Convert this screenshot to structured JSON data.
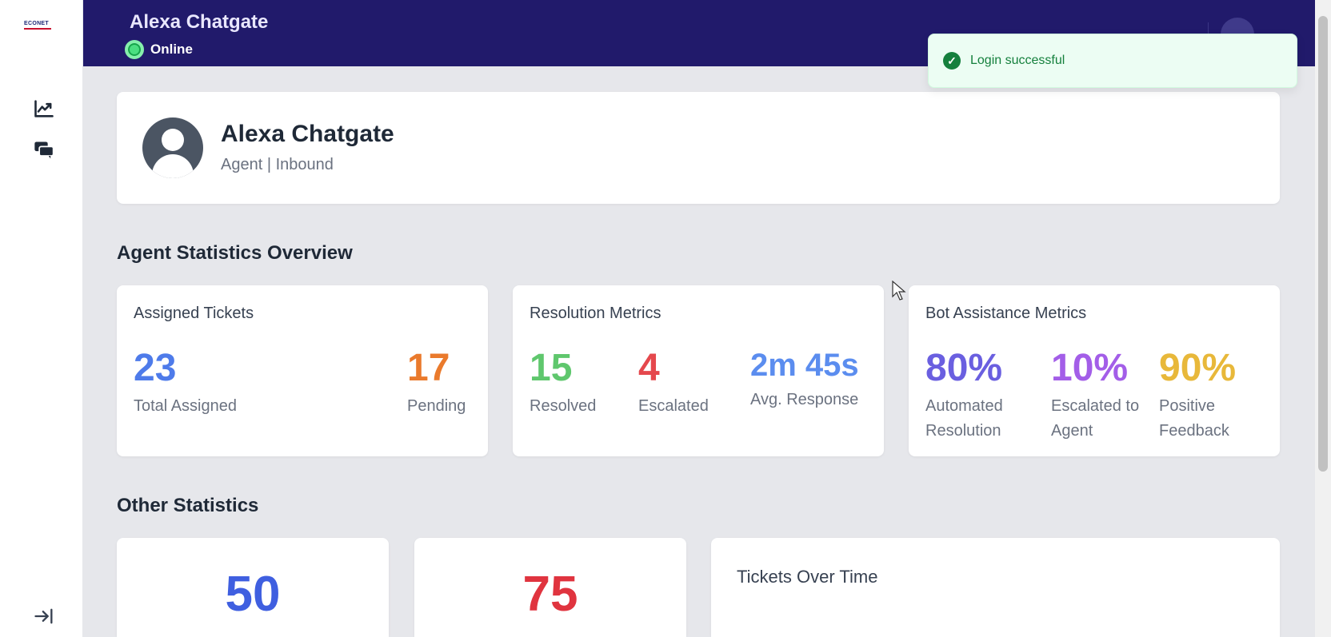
{
  "sidebar": {
    "logo_text": "ECONET",
    "items": [
      {
        "icon": "chart-line-icon"
      },
      {
        "icon": "chat-bubbles-icon"
      }
    ],
    "collapse_icon": "collapse-arrow-icon"
  },
  "header": {
    "title": "Alexa Chatgate",
    "status": "Online",
    "status_color": "#4ade80",
    "background": "#211a6b"
  },
  "toast": {
    "message": "Login successful",
    "icon": "check-circle-icon",
    "color": "#15803d"
  },
  "profile": {
    "name": "Alexa Chatgate",
    "role": "Agent | Inbound",
    "avatar_icon": "user-avatar-icon"
  },
  "overview": {
    "title": "Agent Statistics Overview",
    "cards": [
      {
        "title": "Assigned Tickets",
        "metrics": [
          {
            "value": "23",
            "label": "Total Assigned",
            "color": "#4e7bea"
          },
          {
            "value": "17",
            "label": "Pending",
            "color": "#ea7a2c"
          }
        ]
      },
      {
        "title": "Resolution Metrics",
        "metrics": [
          {
            "value": "15",
            "label": "Resolved",
            "color": "#5fc76d"
          },
          {
            "value": "4",
            "label": "Escalated",
            "color": "#e5484d"
          },
          {
            "value": "2m 45s",
            "label": "Avg. Response",
            "color": "#5b8def"
          }
        ]
      },
      {
        "title": "Bot Assistance Metrics",
        "metrics": [
          {
            "value": "80%",
            "label_line1": "Automated",
            "label_line2": "Resolution",
            "color": "#6a5fe0"
          },
          {
            "value": "10%",
            "label_line1": "Escalated to",
            "label_line2": "Agent",
            "color": "#a35ee8"
          },
          {
            "value": "90%",
            "label_line1": "Positive",
            "label_line2": "Feedback",
            "color": "#e8b83a"
          }
        ]
      }
    ]
  },
  "other": {
    "title": "Other Statistics",
    "stats": [
      {
        "value": "50",
        "color": "#3f5fe0"
      },
      {
        "value": "75",
        "color": "#e0343f"
      }
    ],
    "chart_title": "Tickets Over Time"
  }
}
